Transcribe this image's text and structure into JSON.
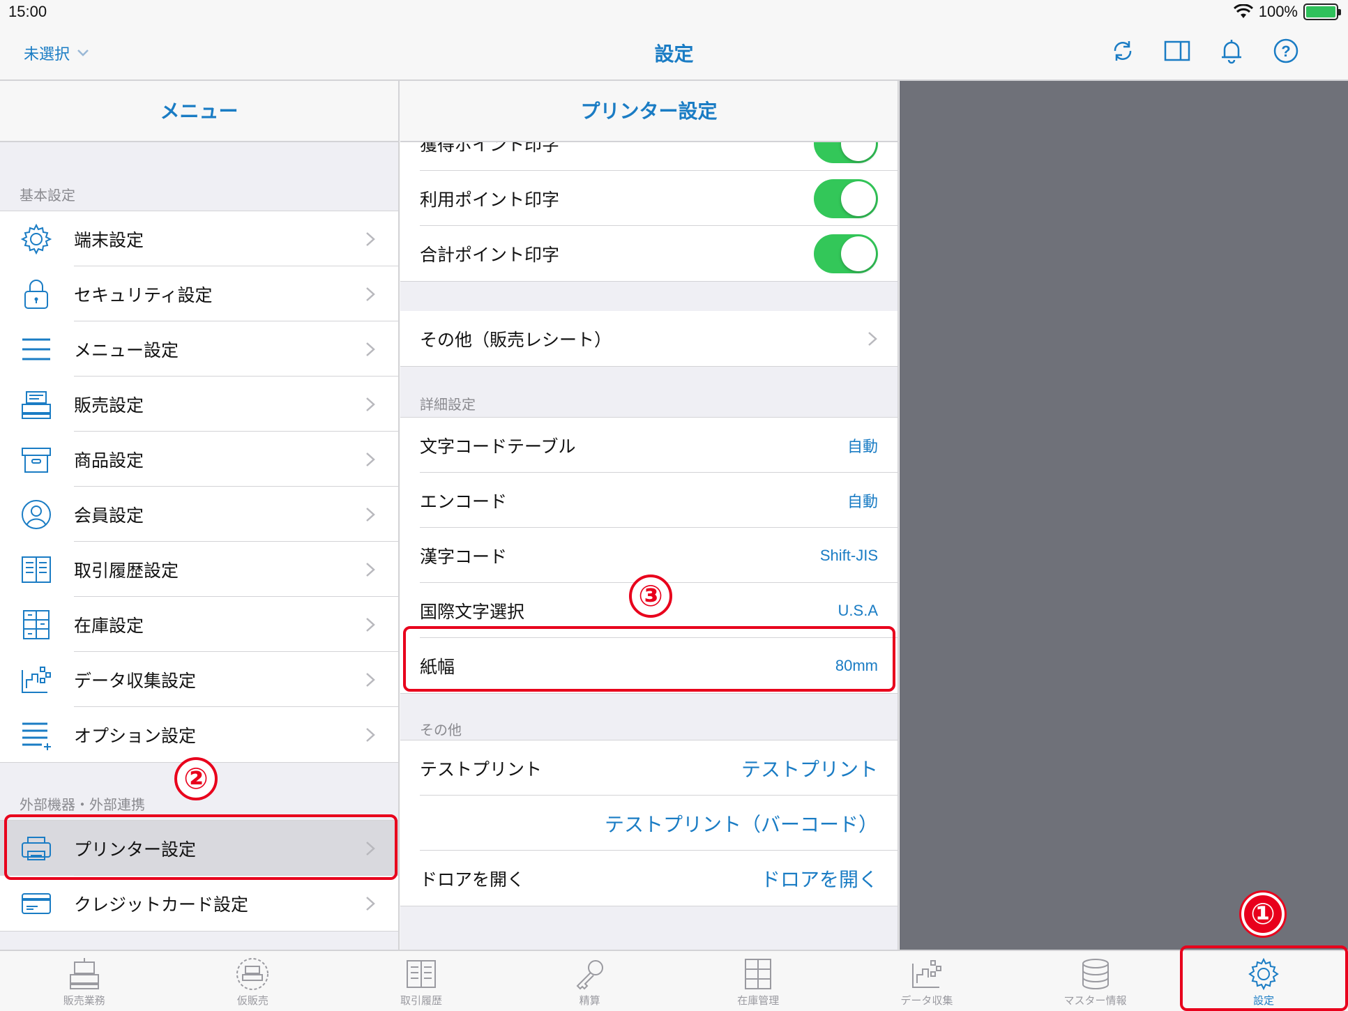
{
  "status_bar": {
    "time": "15:00",
    "battery": "100%"
  },
  "navbar": {
    "left_label": "未選択",
    "title": "設定"
  },
  "menu": {
    "header": "メニュー",
    "section_basic": "基本設定",
    "basic_items": [
      {
        "label": "端末設定",
        "icon": "gear-icon"
      },
      {
        "label": "セキュリティ設定",
        "icon": "lock-icon"
      },
      {
        "label": "メニュー設定",
        "icon": "menu-icon"
      },
      {
        "label": "販売設定",
        "icon": "register-icon"
      },
      {
        "label": "商品設定",
        "icon": "box-icon"
      },
      {
        "label": "会員設定",
        "icon": "person-icon"
      },
      {
        "label": "取引履歴設定",
        "icon": "book-icon"
      },
      {
        "label": "在庫設定",
        "icon": "shelves-icon"
      },
      {
        "label": "データ収集設定",
        "icon": "data-icon"
      },
      {
        "label": "オプション設定",
        "icon": "list-plus-icon"
      }
    ],
    "section_external": "外部機器・外部連携",
    "external_items": [
      {
        "label": "プリンター設定",
        "icon": "printer-icon",
        "selected": true
      },
      {
        "label": "クレジットカード設定",
        "icon": "card-icon"
      }
    ]
  },
  "detail": {
    "header": "プリンター設定",
    "toggles": [
      {
        "label": "獲得ポイント印字",
        "on": true
      },
      {
        "label": "利用ポイント印字",
        "on": true
      },
      {
        "label": "合計ポイント印字",
        "on": true
      }
    ],
    "other_receipt": "その他（販売レシート）",
    "section_advanced": "詳細設定",
    "advanced": [
      {
        "label": "文字コードテーブル",
        "value": "自動"
      },
      {
        "label": "エンコード",
        "value": "自動"
      },
      {
        "label": "漢字コード",
        "value": "Shift-JIS"
      },
      {
        "label": "国際文字選択",
        "value": "U.S.A"
      },
      {
        "label": "紙幅",
        "value": "80mm"
      }
    ],
    "section_other": "その他",
    "actions": [
      {
        "label": "テストプリント",
        "link": "テストプリント"
      },
      {
        "label": "",
        "link": "テストプリント（バーコード）"
      },
      {
        "label": "ドロアを開く",
        "link": "ドロアを開く"
      }
    ]
  },
  "tabbar": [
    {
      "label": "販売業務",
      "icon": "register-icon"
    },
    {
      "label": "仮販売",
      "icon": "temp-register-icon"
    },
    {
      "label": "取引履歴",
      "icon": "book-icon"
    },
    {
      "label": "精算",
      "icon": "key-icon"
    },
    {
      "label": "在庫管理",
      "icon": "shelves-icon"
    },
    {
      "label": "データ収集",
      "icon": "data-icon"
    },
    {
      "label": "マスター情報",
      "icon": "database-icon"
    },
    {
      "label": "設定",
      "icon": "gear-icon",
      "active": true
    }
  ],
  "annotations": {
    "one": "①",
    "two": "②",
    "three": "③"
  },
  "colors": {
    "accent": "#1a7cc4",
    "toggle_on": "#33c759",
    "annotation": "#e8001c"
  }
}
